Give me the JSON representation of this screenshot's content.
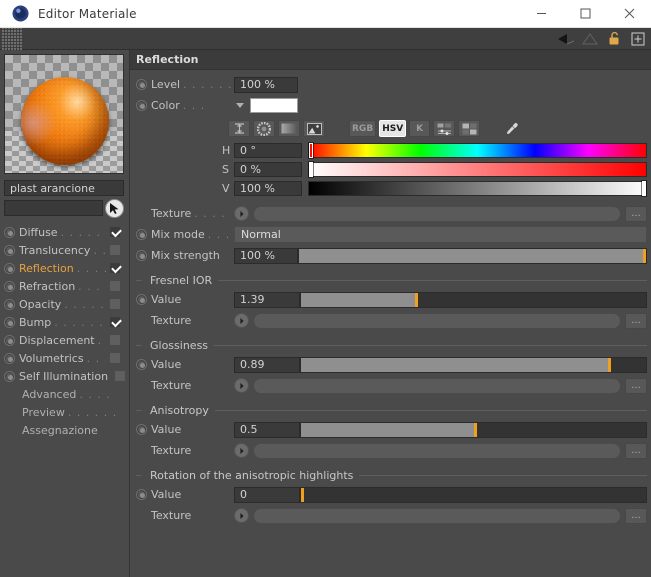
{
  "window": {
    "title": "Editor Materiale",
    "app_icon": "sphere-logo-icon",
    "minimize": "minimize-icon",
    "maximize": "maximize-icon",
    "close": "close-icon"
  },
  "command_strip": {
    "grip": "drag-grip-icon",
    "icons": [
      {
        "name": "back-arrow-icon",
        "state": "enabled"
      },
      {
        "name": "forward-arrow-icon",
        "state": "disabled"
      },
      {
        "name": "lock-open-icon",
        "state": "enabled"
      },
      {
        "name": "add-panel-icon",
        "state": "enabled"
      }
    ]
  },
  "sidebar": {
    "preview_name": "material-preview",
    "material_name": "plast arancione",
    "path_value": "",
    "path_arrow": "dropdown-arrow-icon",
    "picker": "pick-object-icon",
    "channels": [
      {
        "label": "Diffuse",
        "dots": ". . . . . . . . .",
        "checked": true,
        "active": false,
        "has_radio": true
      },
      {
        "label": "Translucency",
        "dots": ". . .",
        "checked": false,
        "active": false,
        "has_radio": true
      },
      {
        "label": "Reflection",
        "dots": ". . . . .",
        "checked": true,
        "active": true,
        "has_radio": true
      },
      {
        "label": "Refraction",
        "dots": ". . . . .",
        "checked": false,
        "active": false,
        "has_radio": true
      },
      {
        "label": "Opacity",
        "dots": ". . . . . . . .",
        "checked": false,
        "active": false,
        "has_radio": true
      },
      {
        "label": "Bump",
        "dots": ". . . . . . . . .",
        "checked": true,
        "active": false,
        "has_radio": true
      },
      {
        "label": "Displacement",
        "dots": ". . .",
        "checked": false,
        "active": false,
        "has_radio": true
      },
      {
        "label": "Volumetrics",
        "dots": ". . . .",
        "checked": false,
        "active": false,
        "has_radio": true
      },
      {
        "label": "Self Illumination",
        "dots": "",
        "checked": false,
        "active": false,
        "has_radio": true
      }
    ],
    "links": [
      {
        "label": "Advanced",
        "dots": ". . . ."
      },
      {
        "label": "Preview",
        "dots": ". . . . . ."
      },
      {
        "label": "Assegnazione",
        "dots": ""
      }
    ]
  },
  "panel": {
    "section_title": "Reflection",
    "level": {
      "label": "Level",
      "dots": ". . . . . . .",
      "value": "100 %"
    },
    "color": {
      "label": "Color",
      "dots": ". . .",
      "swatch": "#ffffff"
    },
    "color_modes": {
      "icons": [
        {
          "name": "eyedropper-range-icon"
        },
        {
          "name": "color-wheel-icon"
        },
        {
          "name": "gradient-icon"
        },
        {
          "name": "image-picker-icon"
        }
      ],
      "buttons": [
        {
          "label": "RGB",
          "active": false
        },
        {
          "label": "HSV",
          "active": true
        },
        {
          "label": "K",
          "active": false
        }
      ],
      "extra_icons": [
        {
          "name": "sliders-icon"
        },
        {
          "name": "swatches-icon"
        }
      ],
      "pipette": "pipette-icon"
    },
    "hsv": [
      {
        "label": "H",
        "value": "0 °",
        "knob_pct": 0,
        "bar": "hue"
      },
      {
        "label": "S",
        "value": "0 %",
        "knob_pct": 0,
        "bar": "saturation"
      },
      {
        "label": "V",
        "value": "100 %",
        "knob_pct": 100,
        "bar": "value"
      }
    ],
    "texture": {
      "label": "Texture",
      "dots": ". . . . . .",
      "value": "",
      "browse": "..."
    },
    "mix_mode": {
      "label": "Mix mode",
      "dots": ". . .",
      "value": "Normal"
    },
    "mix_strength": {
      "label": "Mix strength",
      "dots": "",
      "value": "100 %",
      "fill_pct": 100
    },
    "groups": [
      {
        "title": "Fresnel IOR",
        "value_label": "Value",
        "value": "1.39",
        "fill_pct": 33,
        "texture_label": "Texture",
        "browse": "..."
      },
      {
        "title": "Glossiness",
        "value_label": "Value",
        "value": "0.89",
        "fill_pct": 89,
        "texture_label": "Texture",
        "browse": "..."
      },
      {
        "title": "Anisotropy",
        "value_label": "Value",
        "value": "0.5",
        "fill_pct": 50,
        "texture_label": "Texture",
        "browse": "..."
      },
      {
        "title": "Rotation of the anisotropic highlights",
        "value_label": "Value",
        "value": "0",
        "fill_pct": 0,
        "texture_label": "Texture",
        "browse": "..."
      }
    ]
  },
  "colors": {
    "accent": "#e8a33d",
    "slider_knob": "#f0a020",
    "panel_bg": "#4a4a4a",
    "field_bg": "#3a3a3a"
  }
}
